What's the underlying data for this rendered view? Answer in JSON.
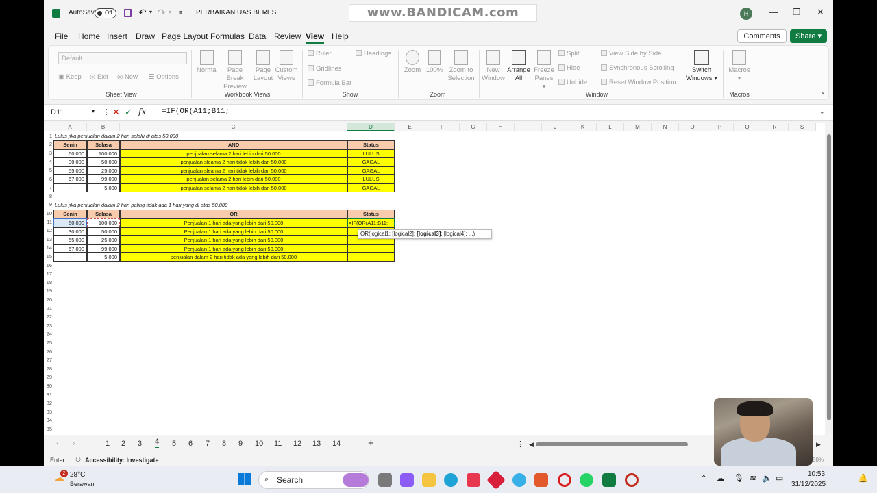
{
  "titlebar": {
    "autosave_label": "AutoSave",
    "autosave_state": "Off",
    "filename": "PERBAIKAN UAS BERES",
    "watermark": "www.BANDICAM.com",
    "user_initial": "H"
  },
  "menu": [
    "File",
    "Home",
    "Insert",
    "Draw",
    "Page Layout",
    "Formulas",
    "Data",
    "Review",
    "View",
    "Help"
  ],
  "menu_active": "View",
  "buttons": {
    "comments": "Comments",
    "share": "Share"
  },
  "ribbon": {
    "sheet_view": {
      "dropdown": "Default",
      "keep": "Keep",
      "exit": "Exit",
      "new": "New",
      "options": "Options",
      "label": "Sheet View"
    },
    "workbook_views": {
      "normal": "Normal",
      "page_break": "Page Break",
      "page_break2": "Preview",
      "page_layout": "Page",
      "page_layout2": "Layout",
      "custom": "Custom",
      "custom2": "Views",
      "label": "Workbook Views"
    },
    "show": {
      "ruler": "Ruler",
      "headings": "Headings",
      "gridlines": "Gridlines",
      "formula_bar": "Formula Bar",
      "label": "Show"
    },
    "zoom": {
      "zoom": "Zoom",
      "z100": "100%",
      "zsel": "Zoom to",
      "zsel2": "Selection",
      "label": "Zoom"
    },
    "window": {
      "new": "New",
      "new2": "Window",
      "arrange": "Arrange",
      "arrange2": "All",
      "freeze": "Freeze",
      "freeze2": "Panes",
      "split": "Split",
      "hide": "Hide",
      "unhide": "Unhide",
      "side": "View Side by Side",
      "sync": "Synchronous Scrolling",
      "reset": "Reset Window Position",
      "switch": "Switch",
      "switch2": "Windows",
      "label": "Window"
    },
    "macros": {
      "macros": "Macros",
      "label": "Macros"
    }
  },
  "formula_bar": {
    "name_box": "D11",
    "formula": "=IF(OR(A11;B11;"
  },
  "columns": [
    "A",
    "B",
    "C",
    "D",
    "E",
    "F",
    "G",
    "H",
    "I",
    "J",
    "K",
    "L",
    "M",
    "N",
    "O",
    "P",
    "Q",
    "R",
    "S"
  ],
  "sheet": {
    "note1": "Lulus jika penjualan dalam 2 hari selalu di atas 50.000",
    "headers1": [
      "Senin",
      "Selasa",
      "AND",
      "Status"
    ],
    "rows1": [
      [
        "60.000",
        "100.000",
        "penjualan selama 2 hari lebih dari 50.000",
        "LULUS"
      ],
      [
        "30.000",
        "50.000",
        "penjualan sleama 2 hari tidak lebih dari 50.000",
        "GAGAL"
      ],
      [
        "55.000",
        "25.000",
        "penjualan sleama 2 hari tidak lebih dari 50.000",
        "GAGAL"
      ],
      [
        "67.000",
        "99.000",
        "penjualan selama 2 hari lebih dari 50.000",
        "LULUS"
      ],
      [
        "-",
        "5.000",
        "penjualan selama 2 hari tidak lebih dari 50.000",
        "GAGAL"
      ]
    ],
    "note2": "Lulus jika penjualan dalam 2 hari paling tidak ada 1 hari yang di atas 50.000",
    "headers2": [
      "Senin",
      "Selasa",
      "OR",
      "Status"
    ],
    "rows2": [
      [
        "60.000",
        "100.000",
        "Penjualan 1 hari ada yang lebih dari 50.000",
        "=IF(OR(A11;B11;"
      ],
      [
        "30.000",
        "50.000",
        "Penjualan 1 hari ada yang lebih dari 50.000",
        ""
      ],
      [
        "55.000",
        "25.000",
        "Penjualan 1 hari ada yang lebih dari 50.000",
        ""
      ],
      [
        "67.000",
        "99.000",
        "Penjualan 1 hari ada yang lebih dari 50.000",
        ""
      ],
      [
        "-",
        "5.000",
        "penjualan dalam 2 hari tidak ada yang lebih dari 50.000",
        ""
      ]
    ],
    "tooltip_pre": "OR(logical1; [logical2]; ",
    "tooltip_bold": "[logical3]",
    "tooltip_post": "; [logical4]; ...)"
  },
  "tabs": [
    "1",
    "2",
    "3",
    "4",
    "5",
    "6",
    "7",
    "8",
    "9",
    "10",
    "11",
    "12",
    "13",
    "14"
  ],
  "active_tab": "4",
  "status": {
    "mode": "Enter",
    "accessibility": "Accessibility: Investigate",
    "zoom": "80%"
  },
  "taskbar": {
    "weather_temp": "28°C",
    "weather_desc": "Berawan",
    "weather_badge": "2",
    "search": "Search",
    "time": "10:53",
    "date": "31/12/2025"
  }
}
